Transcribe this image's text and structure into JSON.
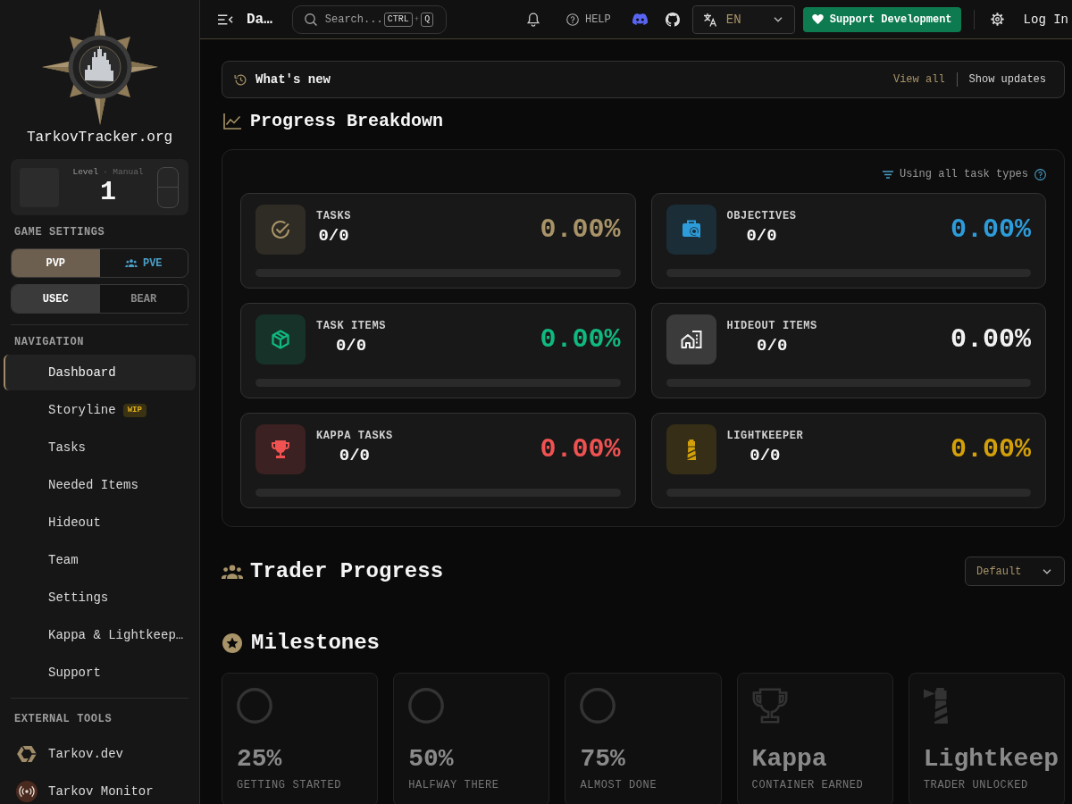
{
  "sidebar": {
    "site_name": "TarkovTracker.org",
    "level_card": {
      "label": "Level",
      "mode": "· Manual",
      "value": "1"
    },
    "game_settings": {
      "title": "GAME SETTINGS",
      "toggles": [
        {
          "options": [
            {
              "label": "PVP",
              "selected": true
            },
            {
              "label": "PVE",
              "selected": false
            }
          ]
        },
        {
          "options": [
            {
              "label": "USEC",
              "selected": true
            },
            {
              "label": "BEAR",
              "selected": false
            }
          ]
        }
      ]
    },
    "navigation": {
      "title": "NAVIGATION",
      "items": [
        {
          "label": "Dashboard",
          "selected": true
        },
        {
          "label": "Storyline",
          "badge": "WIP",
          "selected": false
        },
        {
          "label": "Tasks",
          "selected": false
        },
        {
          "label": "Needed Items",
          "selected": false
        },
        {
          "label": "Hideout",
          "selected": false
        },
        {
          "label": "Team",
          "selected": false
        },
        {
          "label": "Settings",
          "selected": false
        },
        {
          "label": "Kappa & Lightkeep…",
          "selected": false
        },
        {
          "label": "Support",
          "selected": false
        }
      ]
    },
    "external_tools": {
      "title": "EXTERNAL TOOLS",
      "items": [
        {
          "label": "Tarkov.dev"
        },
        {
          "label": "Tarkov Monitor"
        }
      ]
    }
  },
  "top_bar": {
    "page_title": "Da…",
    "search": {
      "placeholder": "Search...",
      "shortcut_keys": [
        "CTRL",
        "Q"
      ],
      "shortcut_joiner": "+"
    },
    "help_label": "HELP",
    "language": "EN",
    "support_button": "Support Development",
    "login_button": "Log In"
  },
  "whats_new": {
    "title": "What's new",
    "view_all": "View all",
    "show_updates": "Show updates"
  },
  "progress_breakdown": {
    "title": "Progress Breakdown",
    "filter_note": "Using all task types",
    "cards": [
      {
        "label": "TASKS",
        "count": "0/0",
        "percent": "0.00%",
        "color": "#a89468",
        "level": 0
      },
      {
        "label": "OBJECTIVES",
        "count": "0/0",
        "percent": "0.00%",
        "color": "#2d9cdb",
        "level": 0
      },
      {
        "label": "TASK ITEMS",
        "count": "0/0",
        "percent": "0.00%",
        "color": "#10b981",
        "level": 0
      },
      {
        "label": "HIDEOUT ITEMS",
        "count": "0/0",
        "percent": "0.00%",
        "color": "#f2f2f2",
        "level": 0
      },
      {
        "label": "KAPPA TASKS",
        "count": "0/0",
        "percent": "0.00%",
        "color": "#f05252",
        "level": 0
      },
      {
        "label": "LIGHTKEEPER",
        "count": "0/0",
        "percent": "0.00%",
        "color": "#d4a00a",
        "level": 0
      }
    ]
  },
  "trader_progress": {
    "title": "Trader Progress",
    "sort": "Default"
  },
  "milestones": {
    "title": "Milestones",
    "items": [
      {
        "value": "25%",
        "caption": "GETTING STARTED",
        "achieved": false
      },
      {
        "value": "50%",
        "caption": "HALFWAY THERE",
        "achieved": false
      },
      {
        "value": "75%",
        "caption": "ALMOST DONE",
        "achieved": false
      },
      {
        "value": "Kappa",
        "caption": "CONTAINER EARNED",
        "achieved": false
      },
      {
        "value": "Lightkeep",
        "caption": "TRADER UNLOCKED",
        "achieved": false
      }
    ]
  }
}
